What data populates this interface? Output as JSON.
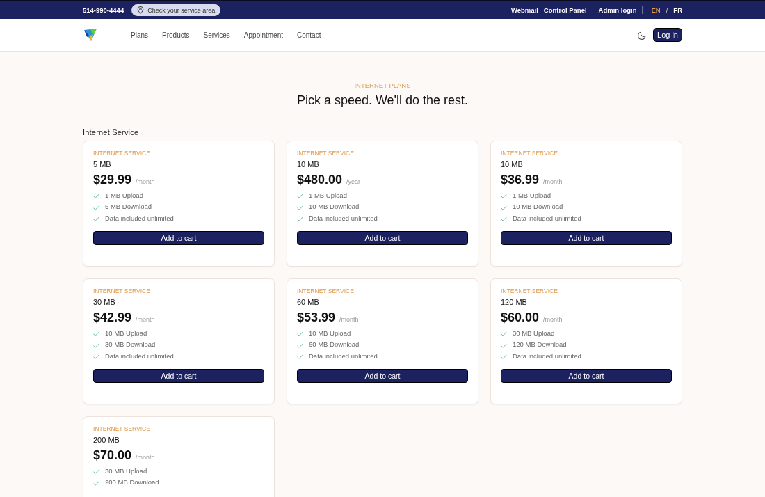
{
  "top_bar": {
    "phone": "514-990-4444",
    "service_area": "Check your service area",
    "links": [
      "Webmail",
      "Control Panel",
      "Admin login"
    ],
    "languages": [
      {
        "label": "EN",
        "selected": true
      },
      {
        "label": "FR",
        "selected": false
      }
    ],
    "lang_separator": "/"
  },
  "nav": {
    "items": [
      "Plans",
      "Products",
      "Services",
      "Appointment",
      "Contact"
    ],
    "login": "Log in"
  },
  "hero": {
    "eyebrow": "INTERNET PLANS",
    "title": "Pick a speed. We'll do the rest."
  },
  "section_title": "Internet Service",
  "plans": [
    {
      "category": "INTERNET SERVICE",
      "name": "5 MB",
      "price": "$29.99",
      "period": "/month",
      "features": [
        "1 MB Upload",
        "5 MB Download",
        "Data included unlimited"
      ],
      "button": "Add to cart"
    },
    {
      "category": "INTERNET SERVICE",
      "name": "10 MB",
      "price": "$480.00",
      "period": "/year",
      "features": [
        "1 MB Upload",
        "10 MB Download",
        "Data included unlimited"
      ],
      "button": "Add to cart"
    },
    {
      "category": "INTERNET SERVICE",
      "name": "10 MB",
      "price": "$36.99",
      "period": "/month",
      "features": [
        "1 MB Upload",
        "10 MB Download",
        "Data included unlimited"
      ],
      "button": "Add to cart"
    },
    {
      "category": "INTERNET SERVICE",
      "name": "30 MB",
      "price": "$42.99",
      "period": "/month",
      "features": [
        "10 MB Upload",
        "30 MB Download",
        "Data included unlimited"
      ],
      "button": "Add to cart"
    },
    {
      "category": "INTERNET SERVICE",
      "name": "60 MB",
      "price": "$53.99",
      "period": "/month",
      "features": [
        "10 MB Upload",
        "60 MB Download",
        "Data included unlimited"
      ],
      "button": "Add to cart"
    },
    {
      "category": "INTERNET SERVICE",
      "name": "120 MB",
      "price": "$60.00",
      "period": "/month",
      "features": [
        "30 MB Upload",
        "120 MB Download",
        "Data included unlimited"
      ],
      "button": "Add to cart"
    },
    {
      "category": "INTERNET SERVICE",
      "name": "200 MB",
      "price": "$70.00",
      "period": "/month",
      "features": [
        "30 MB Upload",
        "200 MB Download"
      ]
    }
  ]
}
